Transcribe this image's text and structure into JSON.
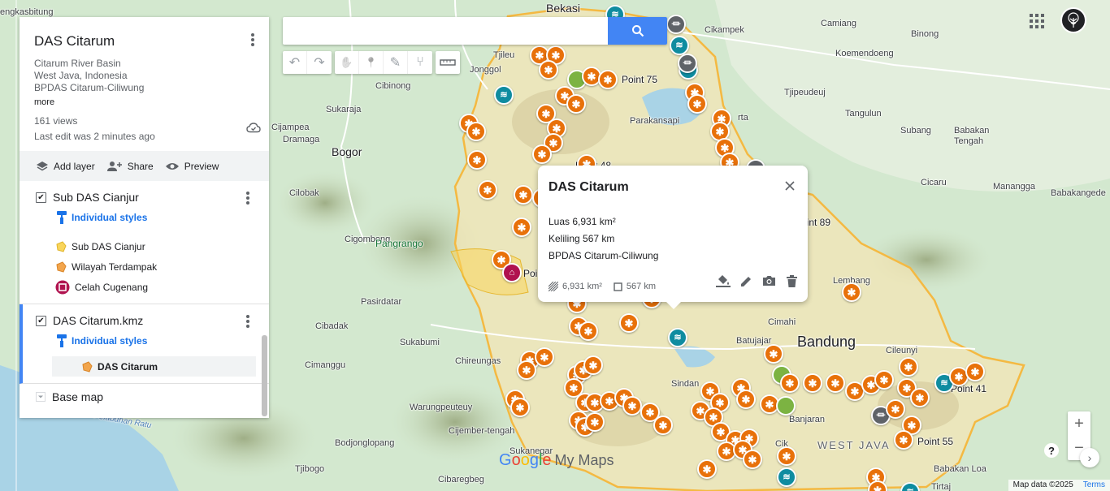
{
  "map": {
    "places": [
      {
        "id": "rengasdengklok",
        "text": "engkasbitung",
        "cls": ""
      },
      {
        "id": "bekasi",
        "text": "Bekasi",
        "cls": "city"
      },
      {
        "id": "cikampek",
        "text": "Cikampek",
        "cls": ""
      },
      {
        "id": "camiang",
        "text": "Camiang",
        "cls": ""
      },
      {
        "id": "binong",
        "text": "Binong",
        "cls": ""
      },
      {
        "id": "koemendoeng",
        "text": "Koemendoeng",
        "cls": ""
      },
      {
        "id": "tjileungsi",
        "text": "Tjileu",
        "cls": ""
      },
      {
        "id": "jonggol",
        "text": "Jonggol",
        "cls": ""
      },
      {
        "id": "cibinong",
        "text": "Cibinong",
        "cls": ""
      },
      {
        "id": "sukaraja",
        "text": "Sukaraja",
        "cls": ""
      },
      {
        "id": "cijampea",
        "text": "Cijampea",
        "cls": ""
      },
      {
        "id": "dramaga",
        "text": "Dramaga",
        "cls": ""
      },
      {
        "id": "bogor",
        "text": "Bogor",
        "cls": "city"
      },
      {
        "id": "tjipeudeuj",
        "text": "Tjipeudeuj",
        "cls": ""
      },
      {
        "id": "tangulun",
        "text": "Tangulun",
        "cls": ""
      },
      {
        "id": "subang",
        "text": "Subang",
        "cls": ""
      },
      {
        "id": "babakan-tengah",
        "text": "Babakan\nTengah",
        "cls": ""
      },
      {
        "id": "manangga",
        "text": "Manangga",
        "cls": ""
      },
      {
        "id": "ciacirü",
        "text": "Cicaru",
        "cls": ""
      },
      {
        "id": "babakangede",
        "text": "Babakangede",
        "cls": ""
      },
      {
        "id": "parakansapi",
        "text": "Parakansapi",
        "cls": ""
      },
      {
        "id": "cilobak",
        "text": "Cilobak",
        "cls": ""
      },
      {
        "id": "cigombong",
        "text": "Cigombong",
        "cls": ""
      },
      {
        "id": "pangrango",
        "text": "Pangrango",
        "cls": "green"
      },
      {
        "id": "pasirdatar",
        "text": "Pasirdatar",
        "cls": ""
      },
      {
        "id": "cibadak",
        "text": "Cibadak",
        "cls": ""
      },
      {
        "id": "sukabumi",
        "text": "Sukabumi",
        "cls": ""
      },
      {
        "id": "chireungas",
        "text": "Chireungas",
        "cls": ""
      },
      {
        "id": "cimanggu",
        "text": "Cimanggu",
        "cls": ""
      },
      {
        "id": "warungpeuteuy",
        "text": "Warungpeuteuy",
        "cls": ""
      },
      {
        "id": "bodjongloponang",
        "text": "Bodjonglopang",
        "cls": ""
      },
      {
        "id": "cijember",
        "text": "Cijember-tengah",
        "cls": ""
      },
      {
        "id": "sukanegar",
        "text": "Sukanegar",
        "cls": ""
      },
      {
        "id": "tjibogo",
        "text": "Tjibogo",
        "cls": ""
      },
      {
        "id": "cibaregbeg",
        "text": "Cibaregbeg",
        "cls": ""
      },
      {
        "id": "lembang",
        "text": "Lembang",
        "cls": ""
      },
      {
        "id": "cimahi",
        "text": "Cimahi",
        "cls": ""
      },
      {
        "id": "batujajar",
        "text": "Batujajar",
        "cls": ""
      },
      {
        "id": "bandung",
        "text": "Bandung",
        "cls": "big"
      },
      {
        "id": "cileunyi",
        "text": "Cileunyi",
        "cls": ""
      },
      {
        "id": "banjaran",
        "text": "Banjaran",
        "cls": ""
      },
      {
        "id": "westjava",
        "text": "WEST JAVA",
        "cls": "region"
      },
      {
        "id": "sindang",
        "text": "Sindan",
        "cls": ""
      },
      {
        "id": "baseloa",
        "text": "Babakan Loa",
        "cls": ""
      },
      {
        "id": "tirta",
        "text": "Tirtaj",
        "cls": ""
      },
      {
        "id": "pelabuhanratu",
        "text": "Pelabuhan Ratu",
        "cls": "water"
      },
      {
        "id": "point75",
        "text": "Point 75",
        "cls": "point"
      },
      {
        "id": "point89",
        "text": "Point 89",
        "cls": "point"
      },
      {
        "id": "point41",
        "text": "Point 41",
        "cls": "point"
      },
      {
        "id": "point55",
        "text": "Point 55",
        "cls": "point"
      },
      {
        "id": "point48",
        "text": "Point 48",
        "cls": "point"
      },
      {
        "id": "pointp",
        "text": "Poi",
        "cls": "point"
      },
      {
        "id": "rta",
        "text": "rta",
        "cls": ""
      },
      {
        "id": "cik",
        "text": "Cik",
        "cls": ""
      }
    ]
  },
  "search": {
    "value": "",
    "placeholder": ""
  },
  "toolbar": {
    "tools": [
      {
        "name": "undo-button",
        "icon": "↶"
      },
      {
        "name": "redo-button",
        "icon": "↷"
      },
      {
        "name": "pan-hand-button",
        "icon": "✋"
      },
      {
        "name": "add-marker-button",
        "icon": "📍"
      },
      {
        "name": "draw-line-button",
        "icon": "✎"
      },
      {
        "name": "add-directions-button",
        "icon": "⑂"
      },
      {
        "name": "measure-button",
        "icon": "▭"
      }
    ]
  },
  "panel": {
    "title": "DAS Citarum",
    "desc1": "Citarum River Basin",
    "desc2": "West Java, Indonesia",
    "desc3": "BPDAS Citarum-Ciliwung",
    "more": "more",
    "views": "161 views",
    "last_edit": "Last edit was 2 minutes ago",
    "add_layer": "Add layer",
    "share": "Share",
    "preview": "Preview",
    "layer1": {
      "name": "Sub DAS Cianjur",
      "styles": "Individual styles",
      "items": [
        {
          "label": "Sub DAS Cianjur",
          "color": "#f9d55c"
        },
        {
          "label": "Wilayah Terdampak",
          "color": "#f2a54c"
        },
        {
          "label": "Celah Cugenang",
          "color": "#b0124f"
        }
      ]
    },
    "layer2": {
      "name": "DAS Citarum.kmz",
      "styles": "Individual styles",
      "item": "DAS Citarum",
      "item_color": "#f2a54c"
    },
    "base_map": "Base map"
  },
  "popup": {
    "title": "DAS Citarum",
    "line1": "Luas 6,931 km²",
    "line2": "Keliling 567 km",
    "line3": "BPDAS Citarum-Ciliwung",
    "area": "6,931 km²",
    "perimeter": "567 km"
  },
  "watermark": {
    "google": "Google",
    "sub": "My Maps"
  },
  "attribution": {
    "data": "Map data ©2025",
    "terms": "Terms"
  },
  "colors": {
    "basin_fill": "#f6e2a8",
    "basin_border": "#f4b942",
    "marker_orange": "#e8710a",
    "marker_teal": "#0f8ca0",
    "marker_green": "#7cb342",
    "accent_blue": "#4285f4",
    "link_blue": "#1a73e8"
  }
}
